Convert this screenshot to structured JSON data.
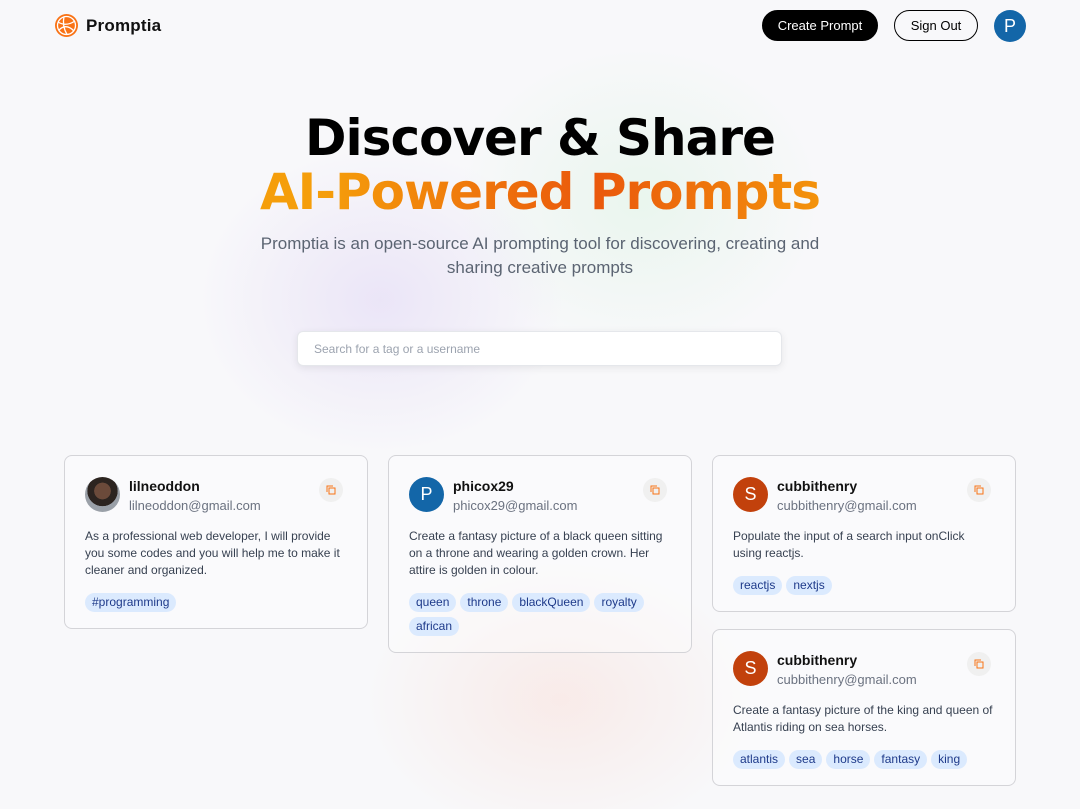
{
  "nav": {
    "brand": "Promptia",
    "create_label": "Create Prompt",
    "signout_label": "Sign Out",
    "avatar_initial": "P"
  },
  "hero": {
    "title_line1": "Discover & Share",
    "title_line2": "AI-Powered Prompts",
    "description": "Promptia is an open-source AI prompting tool for discovering, creating and sharing creative prompts"
  },
  "search": {
    "placeholder": "Search for a tag or a username",
    "value": ""
  },
  "colors": {
    "accent_orange": "#f59e0b",
    "accent_deep_orange": "#ea580c",
    "tag_bg": "#dbeafe",
    "tag_text": "#1e3a8a",
    "avatar_blue": "#1366a8",
    "avatar_red": "#c2410c"
  },
  "cards": [
    {
      "username": "lilneoddon",
      "email": "lilneoddon@gmail.com",
      "avatar": "photo",
      "text": "As a professional web developer, I will provide you some codes and you will help me to make it cleaner and organized.",
      "tags": [
        "#programming"
      ]
    },
    {
      "username": "phicox29",
      "email": "phicox29@gmail.com",
      "avatar": "P",
      "text": "Create a fantasy picture of a black queen sitting on a throne and wearing a golden crown. Her attire is golden in colour.",
      "tags": [
        "queen",
        "throne",
        "blackQueen",
        "royalty",
        "african"
      ]
    },
    {
      "username": "cubbithenry",
      "email": "cubbithenry@gmail.com",
      "avatar": "S",
      "text": "Populate the input of a search input onClick using reactjs.",
      "tags": [
        "reactjs",
        "nextjs"
      ]
    },
    {
      "username": "cubbithenry",
      "email": "cubbithenry@gmail.com",
      "avatar": "S",
      "text": "Create a fantasy picture of the king and queen of Atlantis riding on sea horses.",
      "tags": [
        "atlantis",
        "sea",
        "horse",
        "fantasy",
        "king"
      ]
    }
  ]
}
